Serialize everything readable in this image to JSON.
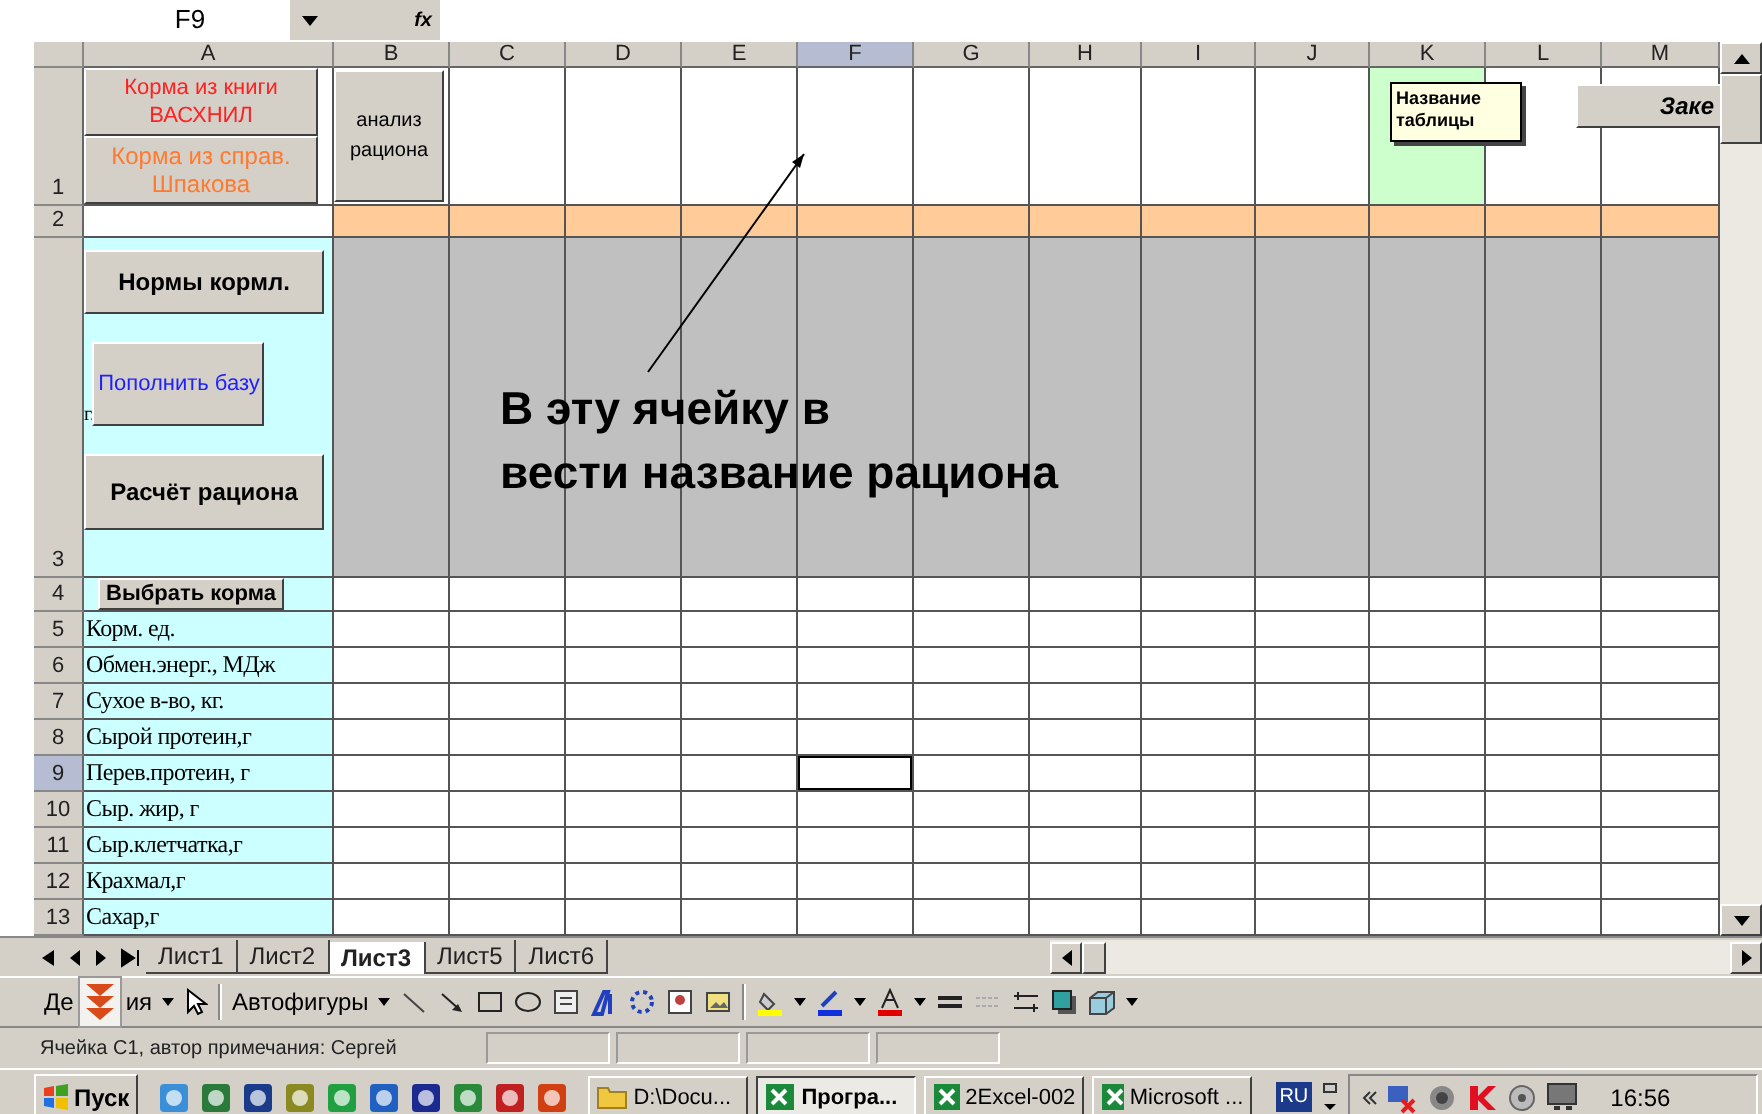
{
  "formula_bar": {
    "name_box": "F9",
    "function_button": "fx"
  },
  "columns": [
    {
      "label": "A",
      "selected": false
    },
    {
      "label": "B",
      "selected": false
    },
    {
      "label": "C",
      "selected": false
    },
    {
      "label": "D",
      "selected": false
    },
    {
      "label": "E",
      "selected": false
    },
    {
      "label": "F",
      "selected": true
    },
    {
      "label": "G",
      "selected": false
    },
    {
      "label": "H",
      "selected": false
    },
    {
      "label": "I",
      "selected": false
    },
    {
      "label": "J",
      "selected": false
    },
    {
      "label": "K",
      "selected": false
    },
    {
      "label": "L",
      "selected": false
    },
    {
      "label": "M",
      "selected": false
    }
  ],
  "rows": [
    {
      "number": "1",
      "selected": false
    },
    {
      "number": "2",
      "selected": false
    },
    {
      "number": "3",
      "selected": false
    },
    {
      "number": "4",
      "selected": false
    },
    {
      "number": "5",
      "selected": false,
      "label": "Корм. ед."
    },
    {
      "number": "6",
      "selected": false,
      "label": "Обмен.энерг., МДж"
    },
    {
      "number": "7",
      "selected": false,
      "label": "Сухое в-во, кг."
    },
    {
      "number": "8",
      "selected": false,
      "label": "Сырой протеин,г"
    },
    {
      "number": "9",
      "selected": true,
      "label": "Перев.протеин, г"
    },
    {
      "number": "10",
      "selected": false,
      "label": "Сыр. жир, г"
    },
    {
      "number": "11",
      "selected": false,
      "label": "Сыр.клетчатка,г"
    },
    {
      "number": "12",
      "selected": false,
      "label": "Крахмал,г"
    },
    {
      "number": "13",
      "selected": false,
      "label": "Сахар,г"
    }
  ],
  "source_buttons": [
    {
      "label": "Корма из книги ВАСХНИЛ",
      "color": "#ff2020"
    },
    {
      "label": "Корма из справ. Шпакова",
      "color": "#ff7a30"
    }
  ],
  "analysis_button": "анализ рациона",
  "panel_buttons": [
    {
      "kind": "bold",
      "label": "Нормы кормл."
    },
    {
      "kind": "plain",
      "label": "Пополнить базу",
      "prefix": "г."
    },
    {
      "kind": "bold",
      "label": "Расчёт рациона"
    }
  ],
  "select_button": "Выбрать корма",
  "close_button": "Заке",
  "note": "Название таблицы",
  "prompt_lines": [
    "В эту ячейку в",
    "вести название рациона"
  ],
  "sheet_tabs": [
    {
      "label": "Лист1",
      "selected": false
    },
    {
      "label": "Лист2",
      "selected": false
    },
    {
      "label": "Лист3",
      "selected": true
    },
    {
      "label": "Лист5",
      "selected": false
    },
    {
      "label": "Лист6",
      "selected": false
    }
  ],
  "draw_toolbar": {
    "actions_start": "Де",
    "actions_end": "ия",
    "autoshapes": "Автофигуры"
  },
  "status": "Ячейка C1, автор примечания: Сергей",
  "taskbar": {
    "start": "Пуск",
    "tasks": [
      {
        "label": "D:\\Docu...",
        "kind": "folder",
        "selected": false
      },
      {
        "label": "Програ...",
        "kind": "excel",
        "selected": true
      },
      {
        "label": "2Excel-002",
        "kind": "excel",
        "selected": false
      },
      {
        "label": "Microsoft ...",
        "kind": "excel",
        "selected": false
      }
    ],
    "language": "RU",
    "clock": "16:56"
  }
}
